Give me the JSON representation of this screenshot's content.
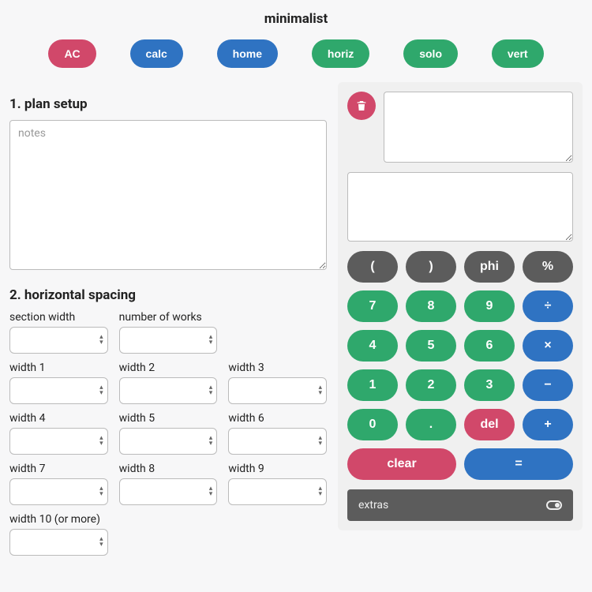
{
  "title": "minimalist",
  "nav": [
    {
      "key": "ac",
      "label": "AC",
      "color": "red"
    },
    {
      "key": "calc",
      "label": "calc",
      "color": "blue"
    },
    {
      "key": "home",
      "label": "home",
      "color": "blue"
    },
    {
      "key": "horiz",
      "label": "horiz",
      "color": "green"
    },
    {
      "key": "solo",
      "label": "solo",
      "color": "green"
    },
    {
      "key": "vert",
      "label": "vert",
      "color": "green"
    }
  ],
  "sections": {
    "plan_setup": {
      "heading": "1. plan setup",
      "notes_placeholder": "notes",
      "notes_value": ""
    },
    "horizontal_spacing": {
      "heading": "2. horizontal spacing",
      "top_fields": [
        {
          "key": "section_width",
          "label": "section width",
          "value": ""
        },
        {
          "key": "number_of_works",
          "label": "number of works",
          "value": ""
        }
      ],
      "width_fields": [
        {
          "key": "w1",
          "label": "width 1",
          "value": ""
        },
        {
          "key": "w2",
          "label": "width 2",
          "value": ""
        },
        {
          "key": "w3",
          "label": "width 3",
          "value": ""
        },
        {
          "key": "w4",
          "label": "width 4",
          "value": ""
        },
        {
          "key": "w5",
          "label": "width 5",
          "value": ""
        },
        {
          "key": "w6",
          "label": "width 6",
          "value": ""
        },
        {
          "key": "w7",
          "label": "width 7",
          "value": ""
        },
        {
          "key": "w8",
          "label": "width 8",
          "value": ""
        },
        {
          "key": "w9",
          "label": "width 9",
          "value": ""
        }
      ],
      "overflow_field": {
        "key": "w10",
        "label": "width 10 (or more)",
        "value": ""
      }
    }
  },
  "calc": {
    "scratch_value": "",
    "display_value": "",
    "keys": {
      "row1": [
        "(",
        ")",
        "phi",
        "%"
      ],
      "digits": [
        "7",
        "8",
        "9",
        "4",
        "5",
        "6",
        "1",
        "2",
        "3",
        "0",
        "."
      ],
      "ops": {
        "div": "÷",
        "mul": "×",
        "sub": "−",
        "add": "+"
      },
      "del": "del",
      "clear": "clear",
      "eq": "="
    },
    "extras_label": "extras"
  },
  "icons": {
    "trash": "trash-icon",
    "toggle": "toggle-icon"
  }
}
